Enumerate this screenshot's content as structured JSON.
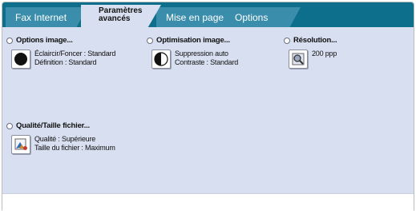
{
  "tabs": [
    {
      "label": "Fax Internet"
    },
    {
      "label": "Paramètres\navancés"
    },
    {
      "label": "Mise en page"
    },
    {
      "label": "Options"
    }
  ],
  "groups": {
    "image_options": {
      "title": "Options image...",
      "line1": "Éclaircir/Foncer : Standard",
      "line2": "Définition : Standard",
      "icon": "contrast-circle-icon"
    },
    "image_optimization": {
      "title": "Optimisation image...",
      "line1": "Suppression auto",
      "line2": "Contraste : Standard",
      "icon": "half-circle-contrast-icon"
    },
    "resolution": {
      "title": "Résolution...",
      "line1": "200 ppp",
      "icon": "magnifier-icon"
    },
    "quality_size": {
      "title": "Qualité/Taille fichier...",
      "line1": "Qualité : Supérieure",
      "line2": "Taille du fichier : Maximum",
      "icon": "image-quality-icon"
    }
  },
  "colors": {
    "tabbar": "#0d6f8c",
    "tab_inactive": "#3a8dab",
    "panel": "#d8dff0"
  }
}
